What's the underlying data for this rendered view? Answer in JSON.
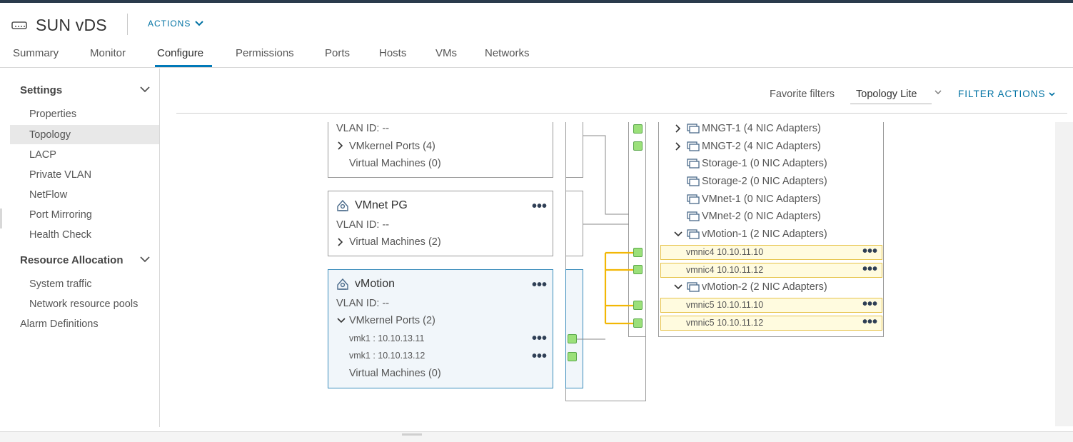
{
  "header": {
    "title": "SUN vDS",
    "actions_label": "ACTIONS"
  },
  "tabs": [
    {
      "label": "Summary"
    },
    {
      "label": "Monitor"
    },
    {
      "label": "Configure"
    },
    {
      "label": "Permissions"
    },
    {
      "label": "Ports"
    },
    {
      "label": "Hosts"
    },
    {
      "label": "VMs"
    },
    {
      "label": "Networks"
    }
  ],
  "active_tab": "Configure",
  "sidebar": {
    "settings_label": "Settings",
    "settings_items": [
      {
        "label": "Properties"
      },
      {
        "label": "Topology"
      },
      {
        "label": "LACP"
      },
      {
        "label": "Private VLAN"
      },
      {
        "label": "NetFlow"
      },
      {
        "label": "Port Mirroring"
      },
      {
        "label": "Health Check"
      }
    ],
    "selected_item": "Topology",
    "resource_label": "Resource Allocation",
    "resource_items": [
      {
        "label": "System traffic"
      },
      {
        "label": "Network resource pools"
      }
    ],
    "alarm_label": "Alarm Definitions"
  },
  "filterbar": {
    "favorite_label": "Favorite filters",
    "selected_filter": "Topology Lite",
    "filter_actions_label": "FILTER ACTIONS"
  },
  "topology": {
    "pg_top": {
      "vlan": "VLAN ID: --",
      "vmkernel": "VMkernel Ports (4)",
      "vms": "Virtual Machines (0)"
    },
    "pg_vmnet": {
      "name": "VMnet PG",
      "vlan": "VLAN ID: --",
      "vms": "Virtual Machines (2)"
    },
    "pg_vmotion": {
      "name": "vMotion",
      "vlan": "VLAN ID: --",
      "vmkernel": "VMkernel Ports (2)",
      "ports": [
        {
          "label": "vmk1 : 10.10.13.11"
        },
        {
          "label": "vmk1 : 10.10.13.12"
        }
      ],
      "vms": "Virtual Machines (0)"
    },
    "uplinks": [
      {
        "label": "MNGT-1 (4 NIC Adapters)"
      },
      {
        "label": "MNGT-2 (4 NIC Adapters)"
      },
      {
        "label": "Storage-1 (0 NIC Adapters)"
      },
      {
        "label": "Storage-2 (0 NIC Adapters)"
      },
      {
        "label": "VMnet-1 (0 NIC Adapters)"
      },
      {
        "label": "VMnet-2 (0 NIC Adapters)"
      },
      {
        "label": "vMotion-1 (2 NIC Adapters)"
      },
      {
        "label": "vMotion-2 (2 NIC Adapters)"
      }
    ],
    "nics": [
      {
        "label": "vmnic4 10.10.11.10"
      },
      {
        "label": "vmnic4 10.10.11.12"
      },
      {
        "label": "vmnic5 10.10.11.10"
      },
      {
        "label": "vmnic5 10.10.11.12"
      }
    ],
    "highlight_color": "#f2b705",
    "port_color": "#9be07a"
  }
}
